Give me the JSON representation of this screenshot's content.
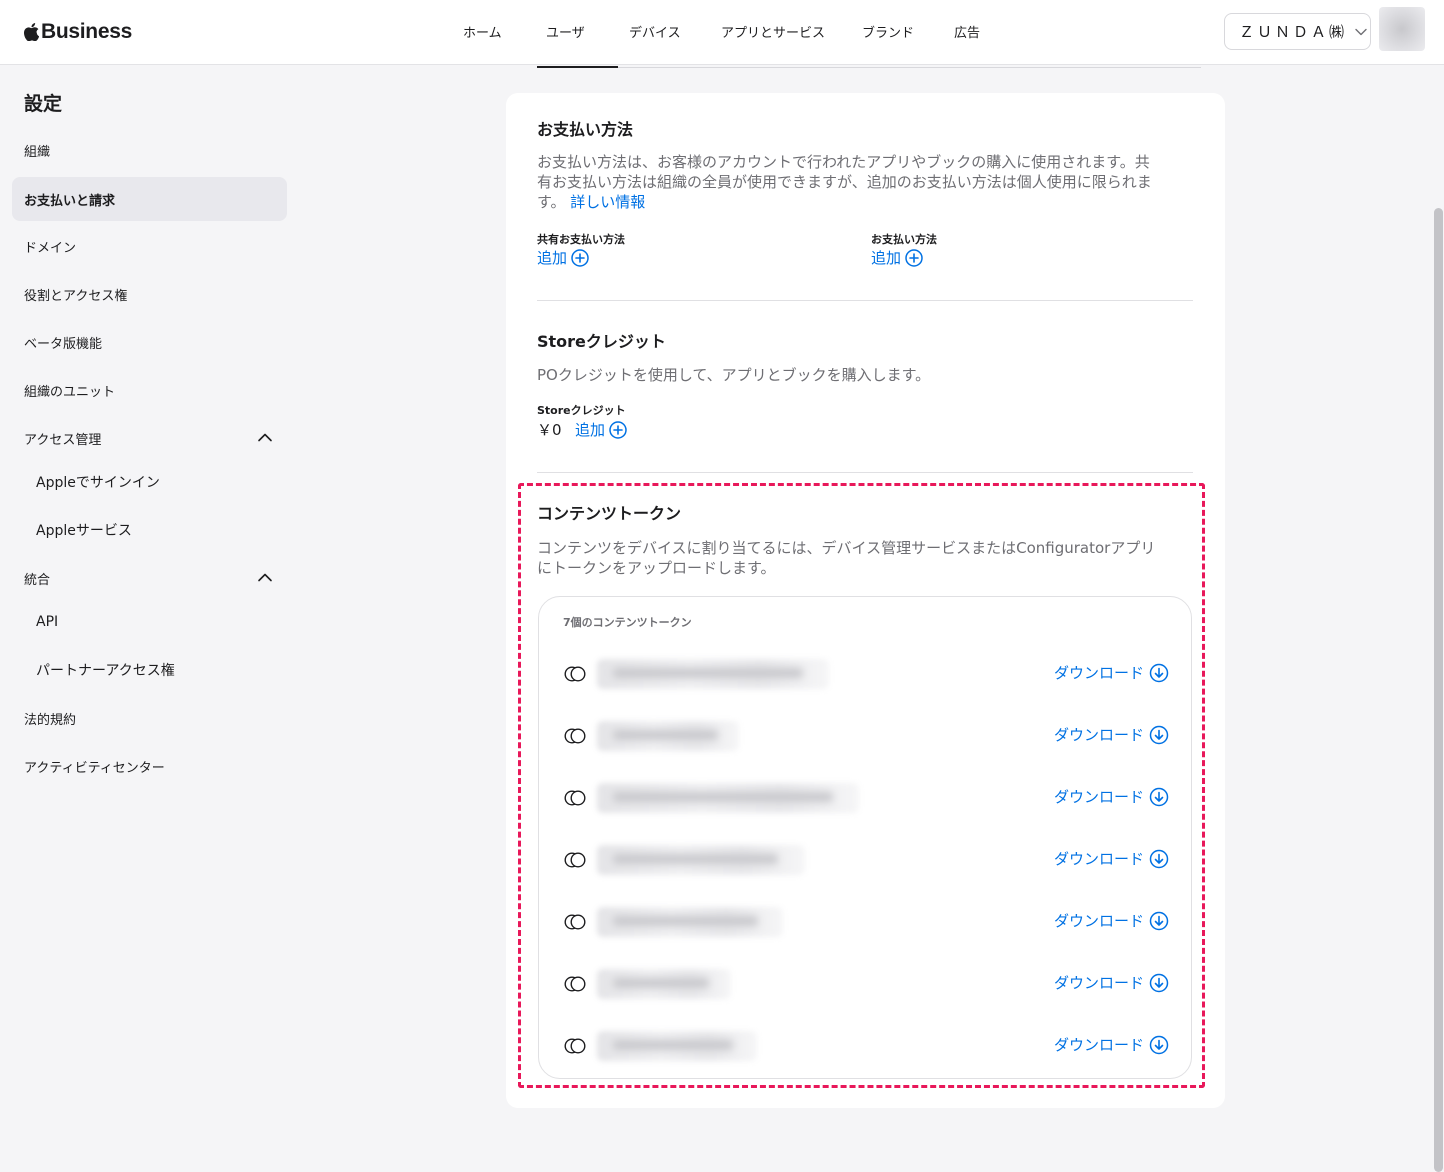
{
  "header": {
    "brand": "Business",
    "nav": [
      "ホーム",
      "ユーザ",
      "デバイス",
      "アプリとサービス",
      "ブランド",
      "広告"
    ],
    "org_name": "ＺＵＮＤＡ㈱"
  },
  "sidebar": {
    "title": "設定",
    "items": [
      {
        "label": "組織"
      },
      {
        "label": "お支払いと請求",
        "active": true
      },
      {
        "label": "ドメイン"
      },
      {
        "label": "役割とアクセス権"
      },
      {
        "label": "ベータ版機能"
      },
      {
        "label": "組織のユニット"
      },
      {
        "label": "アクセス管理",
        "expanded": true
      },
      {
        "label": "Appleでサインイン"
      },
      {
        "label": "Appleサービス"
      },
      {
        "label": "統合",
        "expanded": true
      },
      {
        "label": "API"
      },
      {
        "label": "パートナーアクセス権"
      },
      {
        "label": "法的規約"
      },
      {
        "label": "アクティビティセンター"
      }
    ]
  },
  "payment": {
    "title": "お支払い方法",
    "desc_line1": "お支払い方法は、お客様のアカウントで行われたアプリやブックの購入に使用されます。共",
    "desc_line2": "有お支払い方法は組織の全員が使用できますが、追加のお支払い方法は個人使用に限られま",
    "desc_line3": "す。",
    "learn_more": "詳しい情報",
    "shared_label": "共有お支払い方法",
    "shared_add": "追加",
    "personal_label": "お支払い方法",
    "personal_add": "追加"
  },
  "store_credit": {
    "title": "Storeクレジット",
    "desc": "POクレジットを使用して、アプリとブックを購入します。",
    "label": "Storeクレジット",
    "value": "￥0",
    "add": "追加"
  },
  "content_tokens": {
    "title": "コンテンツトークン",
    "desc_line1": "コンテンツをデバイスに割り当てるには、デバイス管理サービスまたはConfiguratorアプリ",
    "desc_line2": "にトークンをアップロードします。",
    "count_label": "7個のコンテンツトークン",
    "download_label": "ダウンロード",
    "tokens": [
      {
        "redacted": true
      },
      {
        "redacted": true
      },
      {
        "redacted": true
      },
      {
        "redacted": true
      },
      {
        "redacted": true
      },
      {
        "redacted": true
      },
      {
        "redacted": true
      }
    ]
  },
  "colors": {
    "accent": "#0071e3",
    "highlight": "#e8185a",
    "background": "#f5f5f7"
  }
}
